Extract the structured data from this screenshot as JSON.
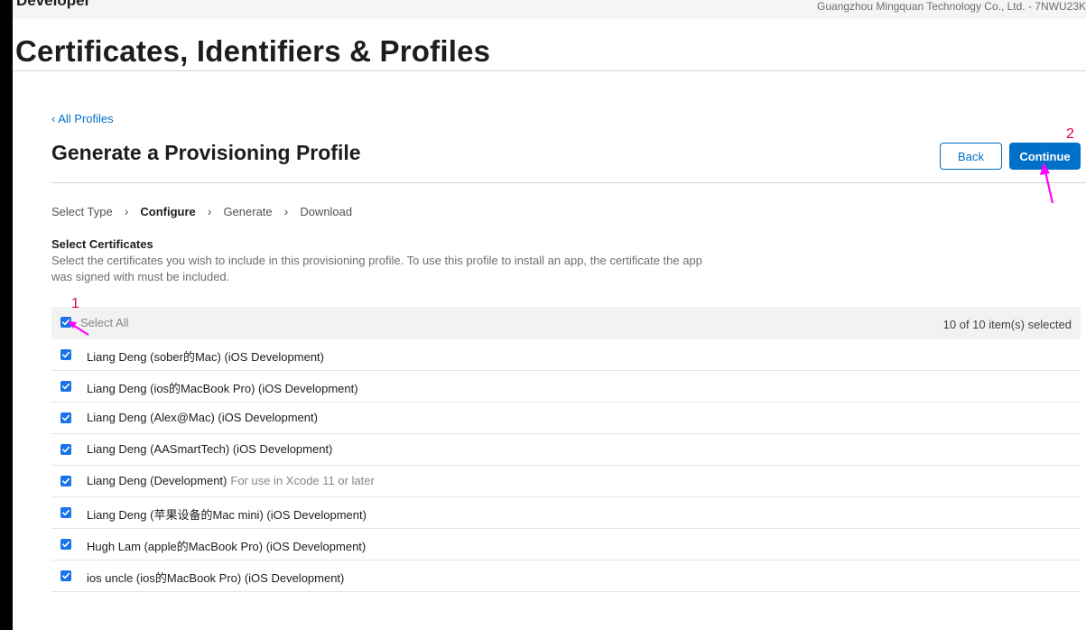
{
  "header": {
    "brand": " Developer",
    "team": "Guangzhou Mingquan Technology Co., Ltd. - 7NWU23K"
  },
  "page": {
    "title": "Certificates, Identifiers & Profiles",
    "back_link": "‹ All Profiles",
    "section_title": "Generate a Provisioning Profile"
  },
  "buttons": {
    "back": "Back",
    "continue": "Continue"
  },
  "steps": [
    {
      "label": "Select Type",
      "active": false
    },
    {
      "label": "Configure",
      "active": true
    },
    {
      "label": "Generate",
      "active": false
    },
    {
      "label": "Download",
      "active": false
    }
  ],
  "certificates_section": {
    "heading": "Select Certificates",
    "description": "Select the certificates you wish to include in this provisioning profile. To use this profile to install an app, the certificate the app was signed with must be included.",
    "select_all_label": "Select All",
    "select_all_checked": true,
    "selected_count": "10 of 10 item(s) selected",
    "items": [
      {
        "name": "Liang Deng (sober的Mac) (iOS Development)",
        "note": "",
        "checked": true
      },
      {
        "name": "Liang Deng (ios的MacBook Pro) (iOS Development)",
        "note": "",
        "checked": true
      },
      {
        "name": "Liang Deng (Alex@Mac) (iOS Development)",
        "note": "",
        "checked": true
      },
      {
        "name": "Liang Deng (AASmartTech) (iOS Development)",
        "note": "",
        "checked": true
      },
      {
        "name": "Liang Deng (Development)",
        "note": "For use in Xcode 11 or later",
        "checked": true
      },
      {
        "name": "Liang Deng (苹果设备的Mac mini) (iOS Development)",
        "note": "",
        "checked": true
      },
      {
        "name": "Hugh Lam (apple的MacBook Pro) (iOS Development)",
        "note": "",
        "checked": true
      },
      {
        "name": "ios uncle (ios的MacBook Pro) (iOS Development)",
        "note": "",
        "checked": true
      }
    ]
  },
  "annotations": {
    "marker_1": "1",
    "marker_2": "2",
    "color": "#ff00ff",
    "number_color": "#e8003d"
  },
  "colors": {
    "accent": "#0070c9",
    "checkbox": "#1a73e8"
  }
}
